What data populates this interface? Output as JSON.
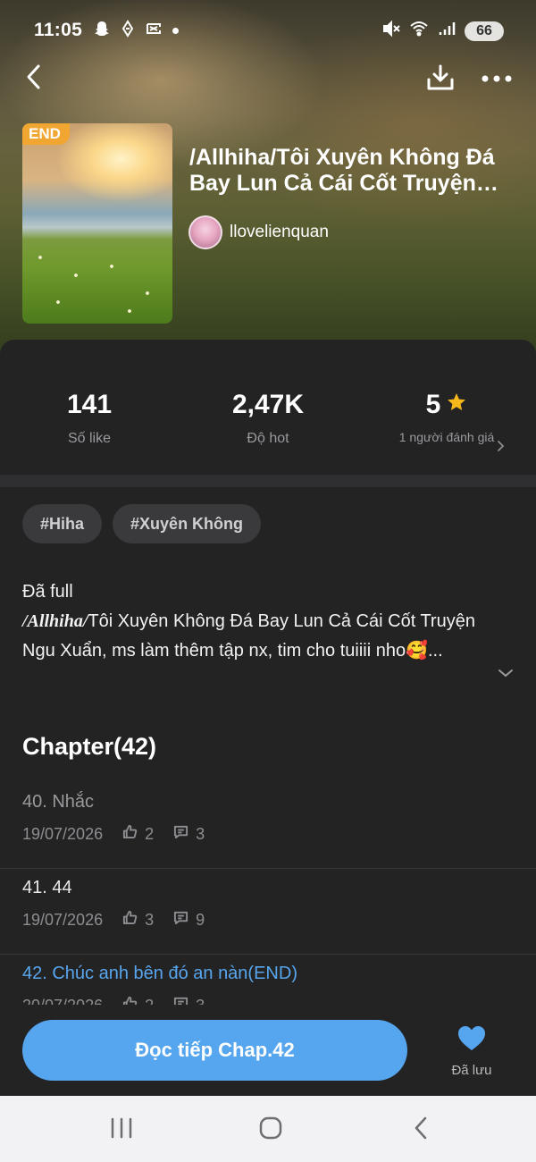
{
  "status_bar": {
    "time": "11:05",
    "battery": "66",
    "left_icons": [
      "snapchat-icon",
      "app-icon",
      "capcut-icon",
      "dot"
    ],
    "right_icons": [
      "mute-icon",
      "wifi-icon",
      "signal-icon"
    ]
  },
  "toolbar": {
    "icons": [
      "chevron-left-icon",
      "download-icon",
      "more-icon"
    ]
  },
  "story": {
    "end_badge": "END",
    "title": "/Allhiha/Tôi Xuyên Không Đá Bay Lun Cả Cái Cốt Truyện Ngu Xuẩn",
    "author": "llovelienquan"
  },
  "stats": {
    "likes_value": "141",
    "likes_label": "Số like",
    "hot_value": "2,47K",
    "hot_label": "Độ hot",
    "rating_value": "5",
    "rating_label": "1 người đánh giá"
  },
  "tags": [
    "#Hiha",
    "#Xuyên Không"
  ],
  "description": {
    "line1": "Đã full",
    "italic_prefix": "/Allhiha/",
    "rest": "Tôi Xuyên Không Đá Bay Lun Cả Cái Cốt Truyện Ngu Xuẩn, ms làm thêm tập nx, tim cho tuiiii nho🥰..."
  },
  "chapters": {
    "heading": "Chapter(42)",
    "items": [
      {
        "title": "40. Nhắc",
        "date": "19/07/2026",
        "likes": "2",
        "comments": "3",
        "state": "read"
      },
      {
        "title": "41. 44",
        "date": "19/07/2026",
        "likes": "3",
        "comments": "9",
        "state": "normal"
      },
      {
        "title": "42. Chúc anh bên đó an nàn(END)",
        "date": "20/07/2026",
        "likes": "2",
        "comments": "3",
        "state": "current"
      }
    ]
  },
  "actions": {
    "read_button": "Đọc tiếp Chap.42",
    "save_label": "Đã lưu"
  },
  "colors": {
    "accent": "#55a5ef",
    "badge": "#f1a632",
    "star": "#f5b81c",
    "dark_bg": "#232324"
  }
}
